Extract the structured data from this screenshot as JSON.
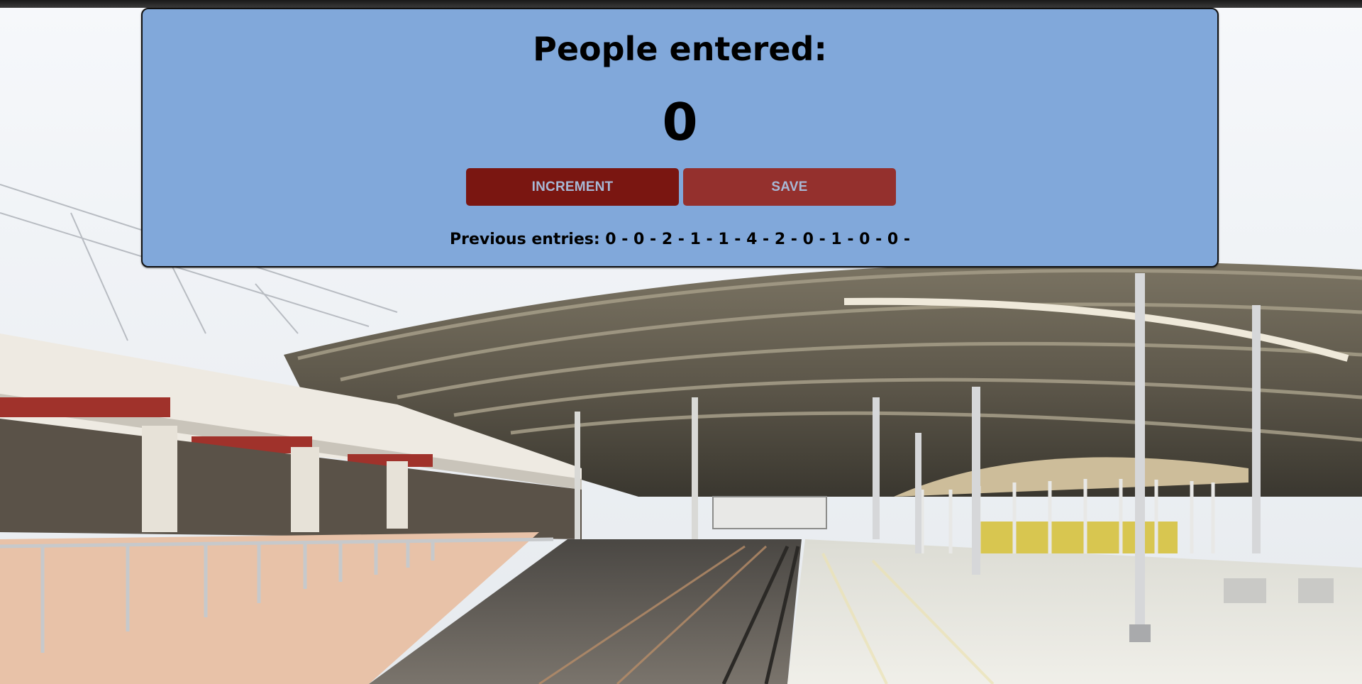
{
  "counter": {
    "title": "People entered:",
    "count": "0",
    "increment_label": "INCREMENT",
    "save_label": "SAVE",
    "previous_entries": "Previous entries: 0 - 0 - 2 - 1 - 1 - 4 - 2 - 0 - 1 - 0 - 0 -"
  },
  "colors": {
    "panel_bg": "#81a8da",
    "increment_bg": "#7a1611",
    "save_bg": "#94302d",
    "button_text": "#a7b9d6"
  },
  "background": {
    "icon": "train-station-photo"
  }
}
